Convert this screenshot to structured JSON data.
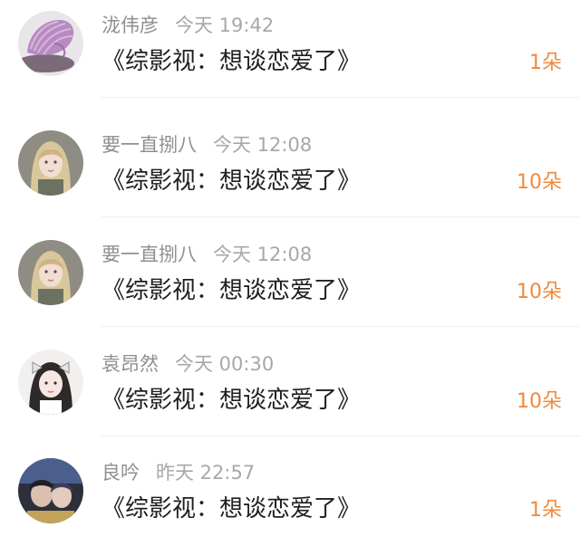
{
  "comments": [
    {
      "username": "泷伟彦",
      "time": "今天 19:42",
      "message": "《综影视：想谈恋爱了》",
      "gift_count": "1朵",
      "avatar_icon": "seashell-avatar"
    },
    {
      "username": "要一直捌八",
      "time": "今天 12:08",
      "message": "《综影视：想谈恋爱了》",
      "gift_count": "10朵",
      "avatar_icon": "girl-portrait-avatar"
    },
    {
      "username": "要一直捌八",
      "time": "今天 12:08",
      "message": "《综影视：想谈恋爱了》",
      "gift_count": "10朵",
      "avatar_icon": "girl-portrait-avatar"
    },
    {
      "username": "袁昂然",
      "time": "今天 00:30",
      "message": "《综影视：想谈恋爱了》",
      "gift_count": "10朵",
      "avatar_icon": "girl-with-bow-avatar"
    },
    {
      "username": "良吟",
      "time": "昨天 22:57",
      "message": "《综影视：想谈恋爱了》",
      "gift_count": "1朵",
      "avatar_icon": "couple-avatar"
    }
  ],
  "colors": {
    "gift_count": "#ef8a3c",
    "username": "#8f8f8f",
    "message": "#1f1f1f"
  }
}
